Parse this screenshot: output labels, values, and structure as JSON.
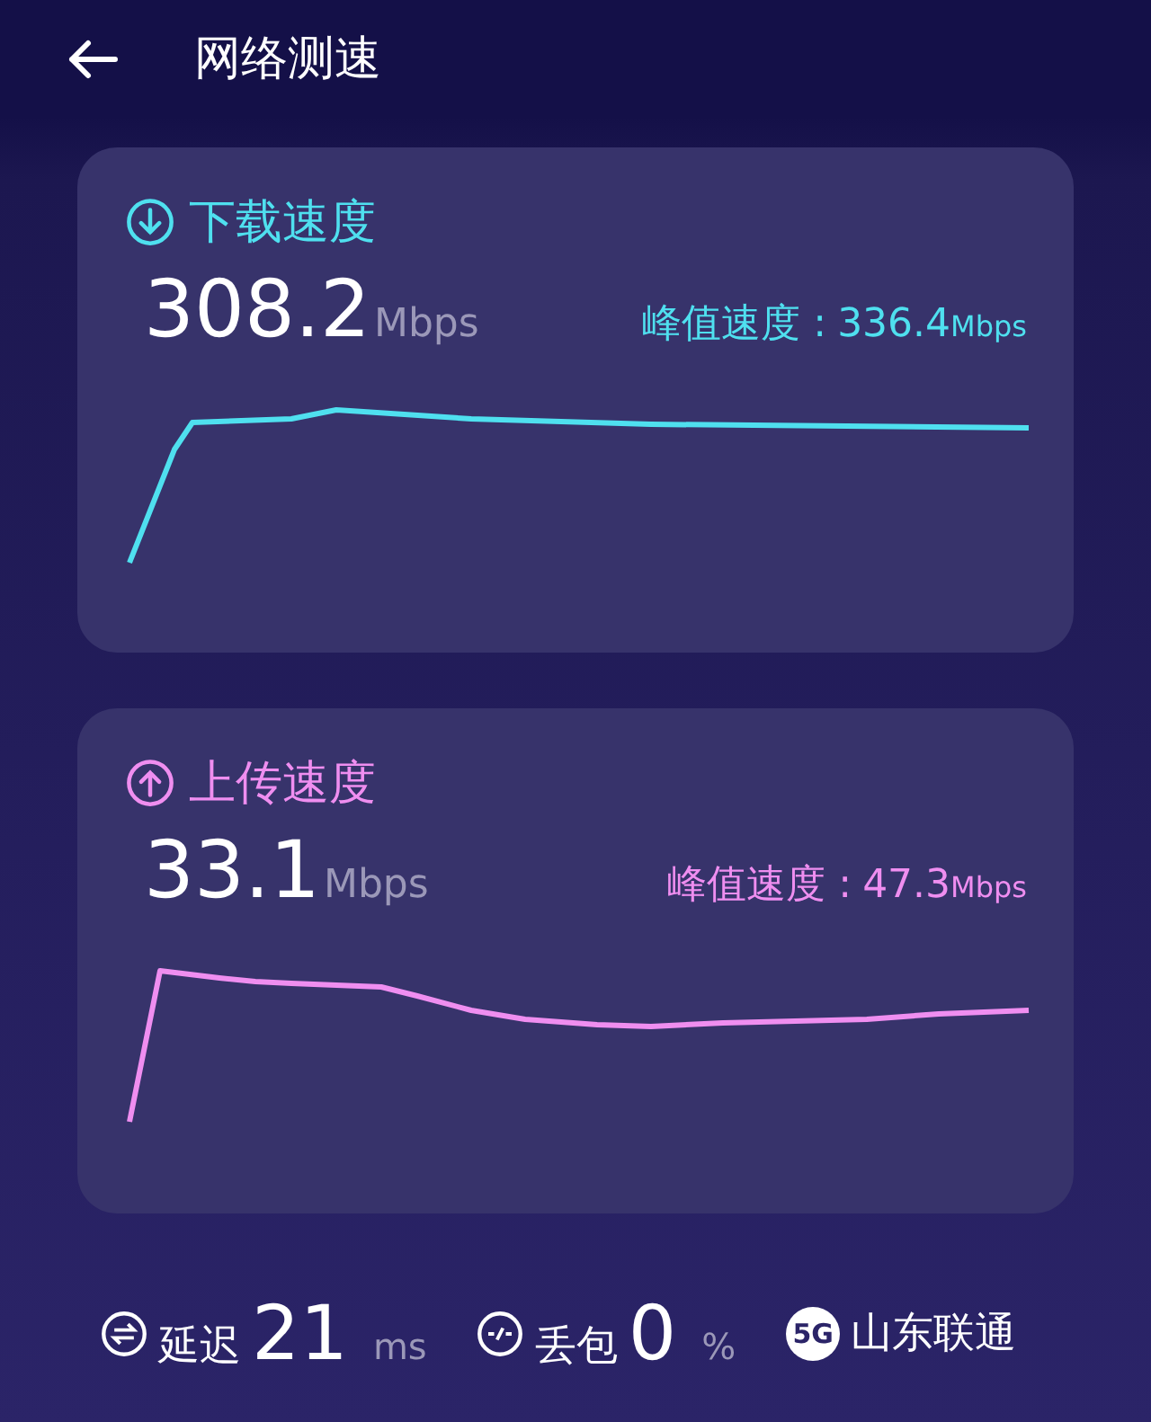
{
  "header": {
    "title": "网络测速"
  },
  "cards": [
    {
      "kind": "download",
      "color": "#4fe0ef",
      "title": "下载速度",
      "value": "308.2",
      "unit": "Mbps",
      "peak_label": "峰值速度 :",
      "peak_value": "336.4",
      "peak_unit": "Mbps"
    },
    {
      "kind": "upload",
      "color": "#ef8ef0",
      "title": "上传速度",
      "value": "33.1",
      "unit": "Mbps",
      "peak_label": "峰值速度 :",
      "peak_value": "47.3",
      "peak_unit": "Mbps"
    }
  ],
  "stats": [
    {
      "kind": "latency",
      "label": "延迟",
      "value": "21",
      "unit": "ms"
    },
    {
      "kind": "loss",
      "label": "丢包",
      "value": "0",
      "unit": "%"
    },
    {
      "kind": "carrier",
      "badge": "5G",
      "label": "山东联通"
    }
  ]
}
